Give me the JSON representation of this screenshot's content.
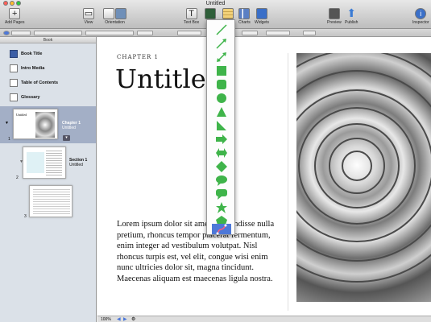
{
  "window": {
    "title": "Untitled"
  },
  "toolbar": {
    "add_pages": "Add Pages",
    "view": "View",
    "orientation": "Orientation",
    "text_box": "Text Box",
    "charts": "Charts",
    "widgets": "Widgets",
    "preview": "Preview",
    "publish": "Publish",
    "inspector": "Inspector"
  },
  "sidebar": {
    "header": "Book",
    "items": [
      {
        "label": "Book Title",
        "icon": "book-icon"
      },
      {
        "label": "Intro Media",
        "icon": "media-icon"
      },
      {
        "label": "Table of Contents",
        "icon": "toc-icon"
      },
      {
        "label": "Glossary",
        "icon": "glossary-icon"
      }
    ],
    "thumbs": [
      {
        "num": "1",
        "title": "Chapter 1",
        "subtitle": "Untitled",
        "thumb_text": "Untitled"
      },
      {
        "num": "2",
        "title": "Section 1",
        "subtitle": "Untitled"
      },
      {
        "num": "3"
      }
    ]
  },
  "document": {
    "chapter_label": "CHAPTER 1",
    "title": "Untitled",
    "body": "Lorem ipsum dolor sit amet, suspendisse nulla pretium, rhoncus tempor placerat fermentum, enim integer ad vestibulum volutpat. Nisl rhoncus turpis est, vel elit, congue wisi enim nunc ultricies dolor sit, magna tincidunt. Maecenas aliquam est maecenas ligula nostra."
  },
  "shapes": [
    "line",
    "arrow-line",
    "double-arrow-line",
    "square",
    "rounded-square",
    "circle",
    "triangle",
    "right-triangle",
    "arrow",
    "double-arrow",
    "diamond",
    "speech-bubble",
    "rounded-callout",
    "star",
    "pentagon",
    "pen-tool"
  ],
  "status": {
    "zoom": "100%"
  },
  "colors": {
    "shape_fill": "#3fb44a",
    "selection": "#4d78d8",
    "sidebar": "#dbe1e8"
  }
}
